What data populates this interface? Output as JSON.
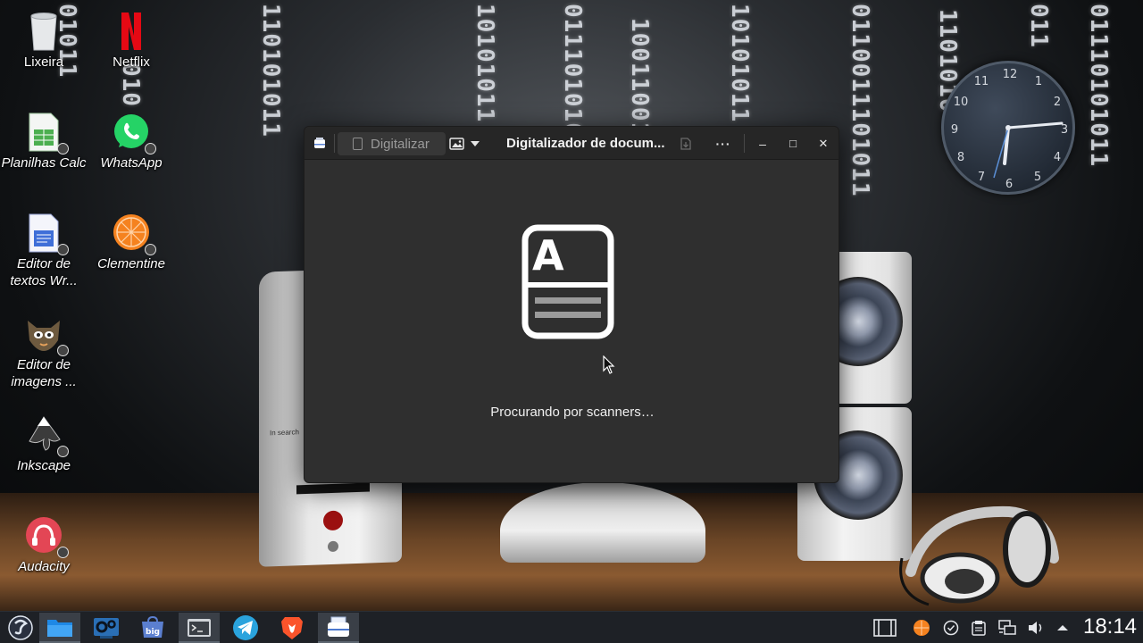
{
  "wallpaper": {
    "binary_columns": [
      "01011",
      "110101011",
      "010",
      "10101011",
      "01110101010",
      "10011001",
      "10101011",
      "0110011101011",
      "1101010",
      "011",
      "01110101011"
    ],
    "speaker_label": "In search",
    "clock_numbers": [
      "12",
      "1",
      "2",
      "3",
      "4",
      "5",
      "6",
      "7",
      "8",
      "9",
      "10",
      "11"
    ]
  },
  "desktop": {
    "icons": [
      {
        "label": "Lixeira",
        "icon": "trash-icon"
      },
      {
        "label": "Netflix",
        "icon": "netflix-icon"
      },
      {
        "label": "Planilhas Calc",
        "icon": "spreadsheet-icon"
      },
      {
        "label": "WhatsApp",
        "icon": "whatsapp-icon"
      },
      {
        "label": "Editor de textos Wr...",
        "icon": "writer-icon"
      },
      {
        "label": "Clementine",
        "icon": "clementine-icon"
      },
      {
        "label": "Editor de imagens ...",
        "icon": "gimp-icon"
      },
      {
        "label": "Inkscape",
        "icon": "inkscape-icon"
      },
      {
        "label": "Audacity",
        "icon": "audacity-icon"
      }
    ]
  },
  "window": {
    "title": "Digitalizador de docum...",
    "scan_button_label": "Digitalizar",
    "menu_glyph": "···",
    "minimize_glyph": "–",
    "maximize_glyph": "□",
    "close_glyph": "✕",
    "doc_letter": "A",
    "status": "Procurando por scanners…"
  },
  "taskbar": {
    "apps": [
      "start-menu-icon",
      "file-manager-icon",
      "system-settings-icon",
      "big-store-icon",
      "terminal-icon",
      "telegram-icon",
      "brave-icon",
      "document-scanner-icon"
    ],
    "tray": [
      "show-desktop-icon",
      "clementine-tray-icon",
      "check-icon",
      "clipboard-icon",
      "network-icon",
      "volume-icon",
      "expand-arrow-icon"
    ],
    "time": "18:14"
  }
}
